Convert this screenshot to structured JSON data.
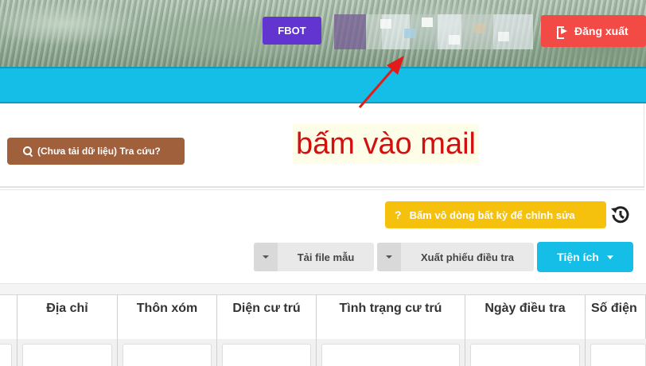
{
  "header": {
    "fbot_label": "FBOT",
    "logout_label": "Đăng xuất"
  },
  "search": {
    "button_label": "(Chưa tải dữ liệu) Tra cứu?"
  },
  "annotation": {
    "text": "bấm vào mail",
    "color": "#d40f0f"
  },
  "toolbar": {
    "hint_label": "Bấm vô dòng bất kỳ để chỉnh sửa",
    "template_label": "Tải file mẫu",
    "export_label": "Xuất phiếu điều tra",
    "utility_label": "Tiện ích"
  },
  "table": {
    "columns": [
      "Địa chỉ",
      "Thôn xóm",
      "Diện cư trú",
      "Tình trạng cư trú",
      "Ngày điều tra",
      "Số điện"
    ]
  },
  "colors": {
    "fbot": "#6235d0",
    "logout": "#f24b45",
    "cyan": "#14bee6",
    "search_button": "#a0603c",
    "hint_button": "#f6c10c"
  }
}
